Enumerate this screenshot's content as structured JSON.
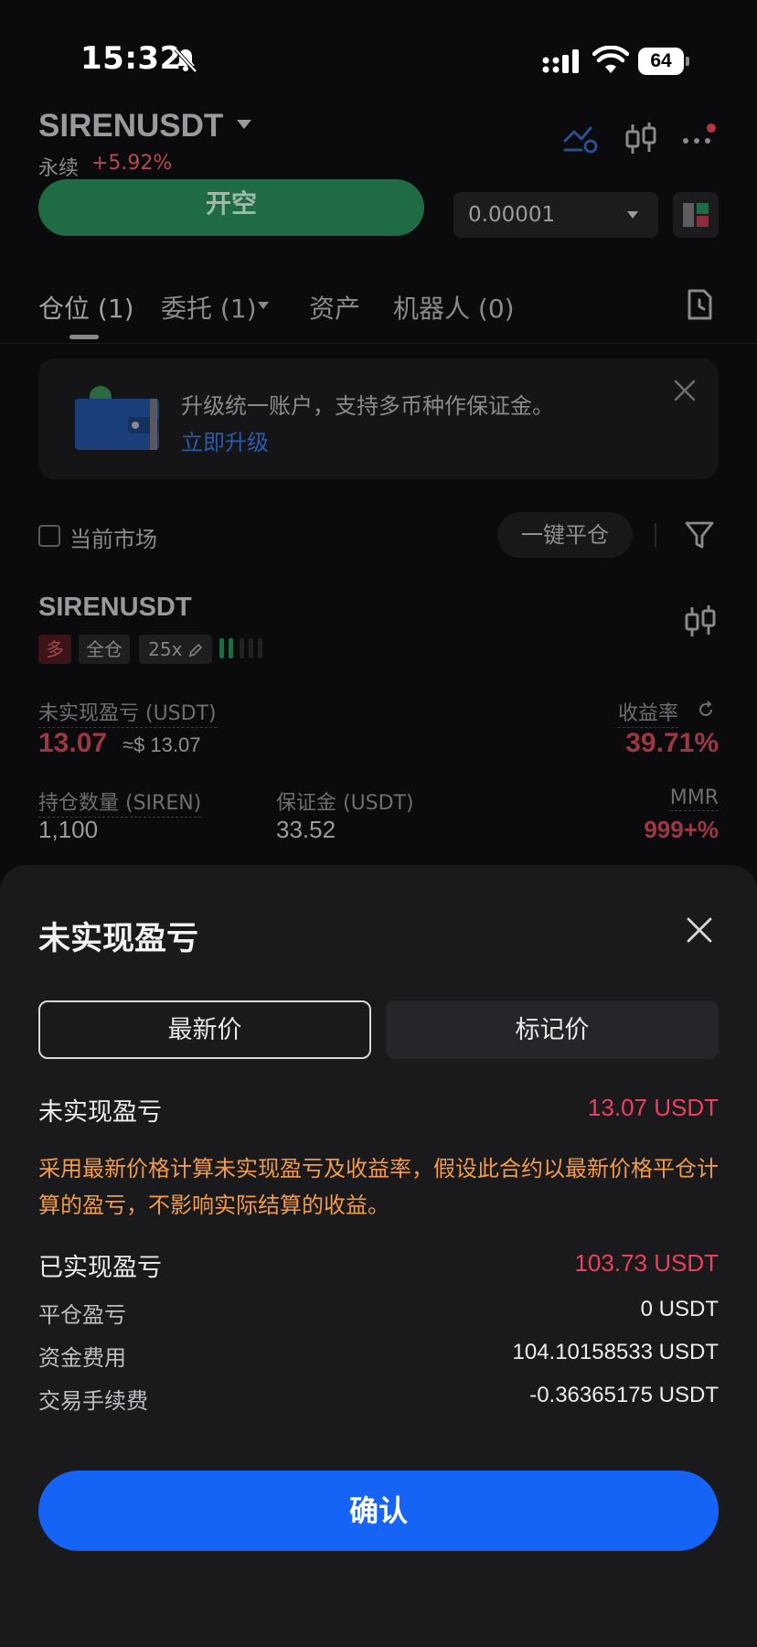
{
  "status_bar": {
    "time": "15:32",
    "battery": "64"
  },
  "header": {
    "symbol": "SIRENUSDT",
    "contract_type": "永续",
    "change": "+5.92%"
  },
  "order_panel": {
    "open_short_label": "开空",
    "quantity_step": "0.00001"
  },
  "tabs": [
    {
      "label": "仓位 (1)"
    },
    {
      "label": "委托 (1)"
    },
    {
      "label": "资产"
    },
    {
      "label": "机器人 (0)"
    }
  ],
  "banner": {
    "text": "升级统一账户，支持多币种作保证金。",
    "link": "立即升级"
  },
  "filters": {
    "current_market": "当前市场",
    "close_all": "一键平仓"
  },
  "position": {
    "symbol": "SIRENUSDT",
    "side": "多",
    "margin_mode": "全仓",
    "leverage": "25x",
    "unrealized_pnl_label": "未实现盈亏 (USDT)",
    "unrealized_pnl": "13.07",
    "unrealized_pnl_usd": "≈$ 13.07",
    "roe_label": "收益率",
    "roe": "39.71%",
    "size_label": "持仓数量 (SIREN)",
    "size": "1,100",
    "margin_label": "保证金 (USDT)",
    "margin": "33.52",
    "mmr_label": "MMR",
    "mmr": "999+%"
  },
  "sheet": {
    "title": "未实现盈亏",
    "segments": [
      "最新价",
      "标记价"
    ],
    "selected_segment": "最新价",
    "unrealized_label": "未实现盈亏",
    "unrealized_value": "13.07 USDT",
    "note": "采用最新价格计算未实现盈亏及收益率，假设此合约以最新价格平仓计算的盈亏，不影响实际结算的收益。",
    "realized_label": "已实现盈亏",
    "realized_value": "103.73 USDT",
    "details": [
      {
        "label": "平仓盈亏",
        "value": "0 USDT"
      },
      {
        "label": "资金费用",
        "value": "104.10158533 USDT"
      },
      {
        "label": "交易手续费",
        "value": "-0.36365175 USDT"
      }
    ],
    "confirm_label": "确认"
  },
  "colors": {
    "accent_blue": "#1564f6",
    "loss_red": "#ef3f5f",
    "note_orange": "#f19b4a",
    "buy_green": "#1f6b43"
  }
}
